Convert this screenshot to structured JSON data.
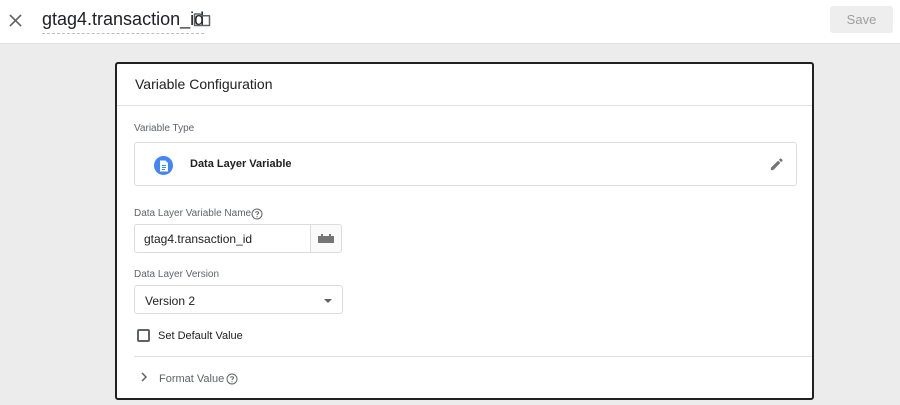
{
  "header": {
    "title": "gtag4.transaction_id",
    "save_label": "Save"
  },
  "card": {
    "title": "Variable Configuration",
    "variable_type_label": "Variable Type",
    "variable_type_value": "Data Layer Variable",
    "name_label": "Data Layer Variable Name",
    "name_value": "gtag4.transaction_id",
    "version_label": "Data Layer Version",
    "version_value": "Version 2",
    "default_value_label": "Set Default Value",
    "format_value_label": "Format Value"
  },
  "colors": {
    "accent": "#4285f4",
    "card_border": "#212121",
    "background": "#ececec"
  }
}
